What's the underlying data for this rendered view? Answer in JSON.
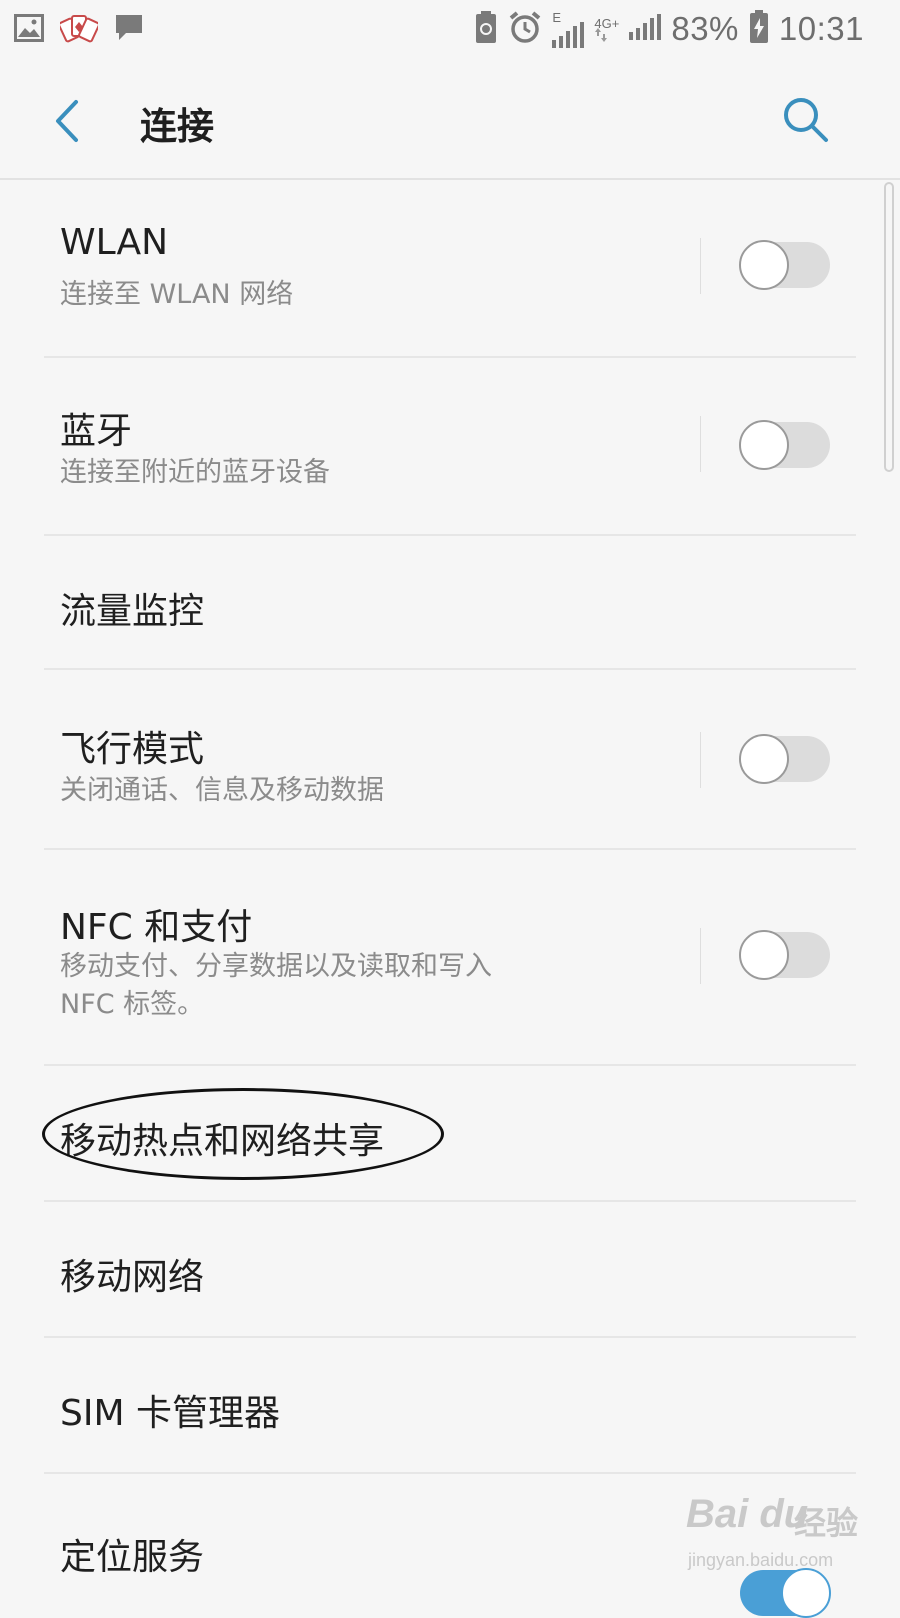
{
  "status_bar": {
    "battery_percent": "83%",
    "time": "10:31",
    "network_1": "E",
    "network_2": "4G+",
    "left_icons": [
      "image-notification-icon",
      "poker-cards-notification-icon",
      "message-notification-icon"
    ],
    "right_icons": [
      "battery-saver-icon",
      "alarm-icon",
      "signal-icon",
      "signal-icon",
      "battery-charging-icon"
    ]
  },
  "header": {
    "title": "连接",
    "back_icon": "chevron-left-icon",
    "search_icon": "search-icon"
  },
  "settings": {
    "wlan": {
      "title": "WLAN",
      "subtitle": "连接至 WLAN 网络",
      "enabled": false
    },
    "bluetooth": {
      "title": "蓝牙",
      "subtitle": "连接至附近的蓝牙设备",
      "enabled": false
    },
    "data_usage": {
      "title": "流量监控"
    },
    "airplane": {
      "title": "飞行模式",
      "subtitle": "关闭通话、信息及移动数据",
      "enabled": false
    },
    "nfc": {
      "title": "NFC 和支付",
      "subtitle": "移动支付、分享数据以及读取和写入 NFC 标签。",
      "enabled": false
    },
    "hotspot": {
      "title": "移动热点和网络共享",
      "annotated": true
    },
    "mobile_networks": {
      "title": "移动网络"
    },
    "sim_manager": {
      "title": "SIM 卡管理器"
    },
    "location": {
      "title": "定位服务",
      "enabled": true
    }
  },
  "colors": {
    "accent": "#4a9fd6",
    "background": "#f6f6f6",
    "primary_text": "#1f1f1f",
    "secondary_text": "#8b8b8b"
  },
  "watermark": {
    "logo": "Bai du",
    "label": "经验",
    "url": "jingyan.baidu.com"
  }
}
